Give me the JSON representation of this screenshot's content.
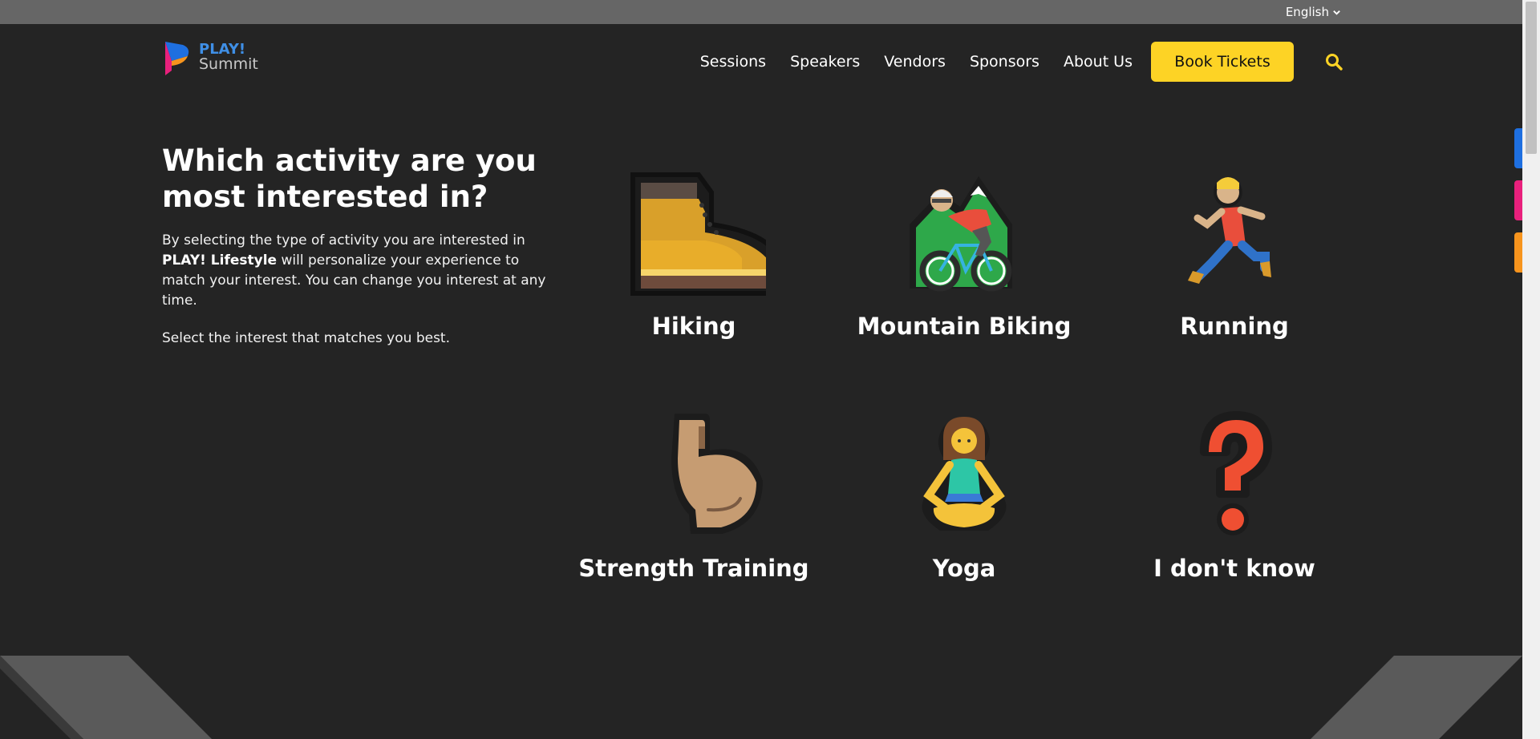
{
  "topbar": {
    "language": "English"
  },
  "logo": {
    "line1": "PLAY!",
    "line2": "Summit"
  },
  "nav": {
    "items": [
      "Sessions",
      "Speakers",
      "Vendors",
      "Sponsors",
      "About Us"
    ],
    "cta": "Book Tickets"
  },
  "intro": {
    "heading": "Which activity are you most interested in?",
    "p1_before": "By selecting the type of activity you are interested in ",
    "p1_bold": "PLAY! Lifestyle",
    "p1_after": " will personalize your experience to match your interest. You can change you interest at any time.",
    "p2": "Select the interest that matches you best."
  },
  "activities": [
    {
      "label": "Hiking",
      "icon": "hiking-boot-icon"
    },
    {
      "label": "Mountain Biking",
      "icon": "mountain-biker-icon"
    },
    {
      "label": "Running",
      "icon": "runner-icon"
    },
    {
      "label": "Strength Training",
      "icon": "flexed-biceps-icon"
    },
    {
      "label": "Yoga",
      "icon": "yoga-person-icon"
    },
    {
      "label": "I don't know",
      "icon": "question-mark-icon"
    }
  ],
  "colors": {
    "background": "#242424",
    "topbar": "#666666",
    "cta": "#fdd325",
    "sidetabs": [
      "#1e6fe0",
      "#e8207c",
      "#f7941d"
    ]
  }
}
